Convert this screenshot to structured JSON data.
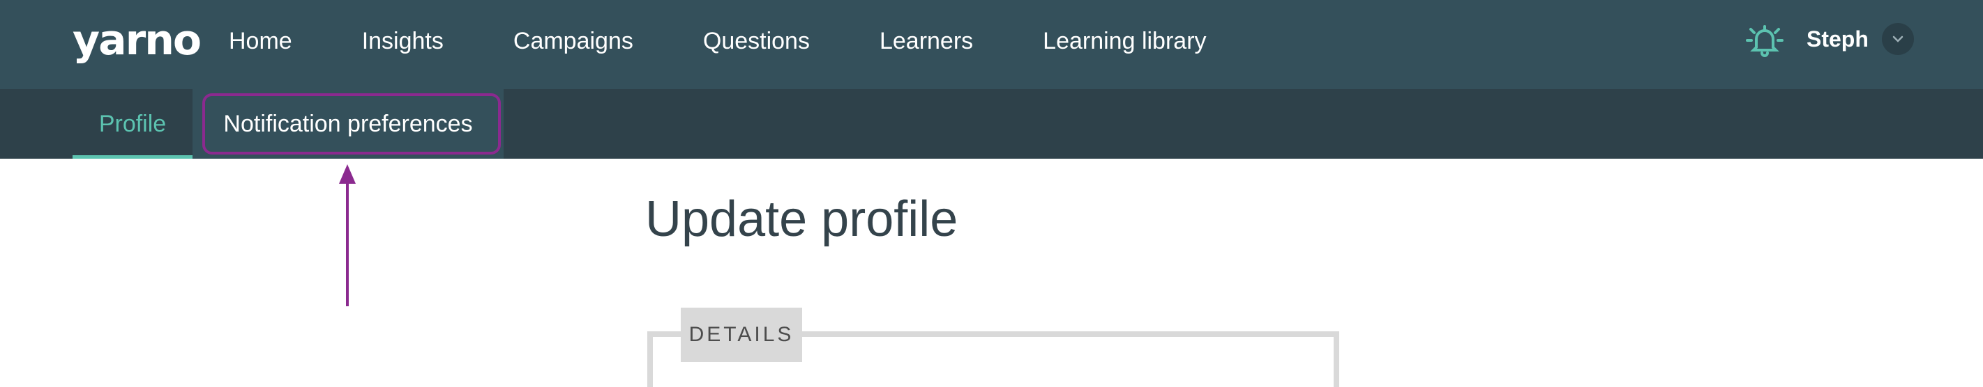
{
  "app": {
    "logo_text": "yarno"
  },
  "nav": {
    "links": [
      {
        "label": "Home"
      },
      {
        "label": "Insights"
      },
      {
        "label": "Campaigns"
      },
      {
        "label": "Questions"
      },
      {
        "label": "Learners"
      },
      {
        "label": "Learning library"
      }
    ],
    "user_name": "Steph",
    "icons": {
      "notifications": "bell-icon",
      "user_menu": "chevron-down-icon"
    }
  },
  "subnav": {
    "tabs": [
      {
        "label": "Profile",
        "active": true
      },
      {
        "label": "Notification preferences",
        "active": false
      }
    ]
  },
  "main": {
    "title": "Update profile",
    "section_label": "DETAILS"
  },
  "colors": {
    "nav_background": "#34505b",
    "subnav_background": "#2e414a",
    "accent": "#5cc3b0",
    "annotation": "#8b2a8f",
    "title_text": "#34434b"
  }
}
